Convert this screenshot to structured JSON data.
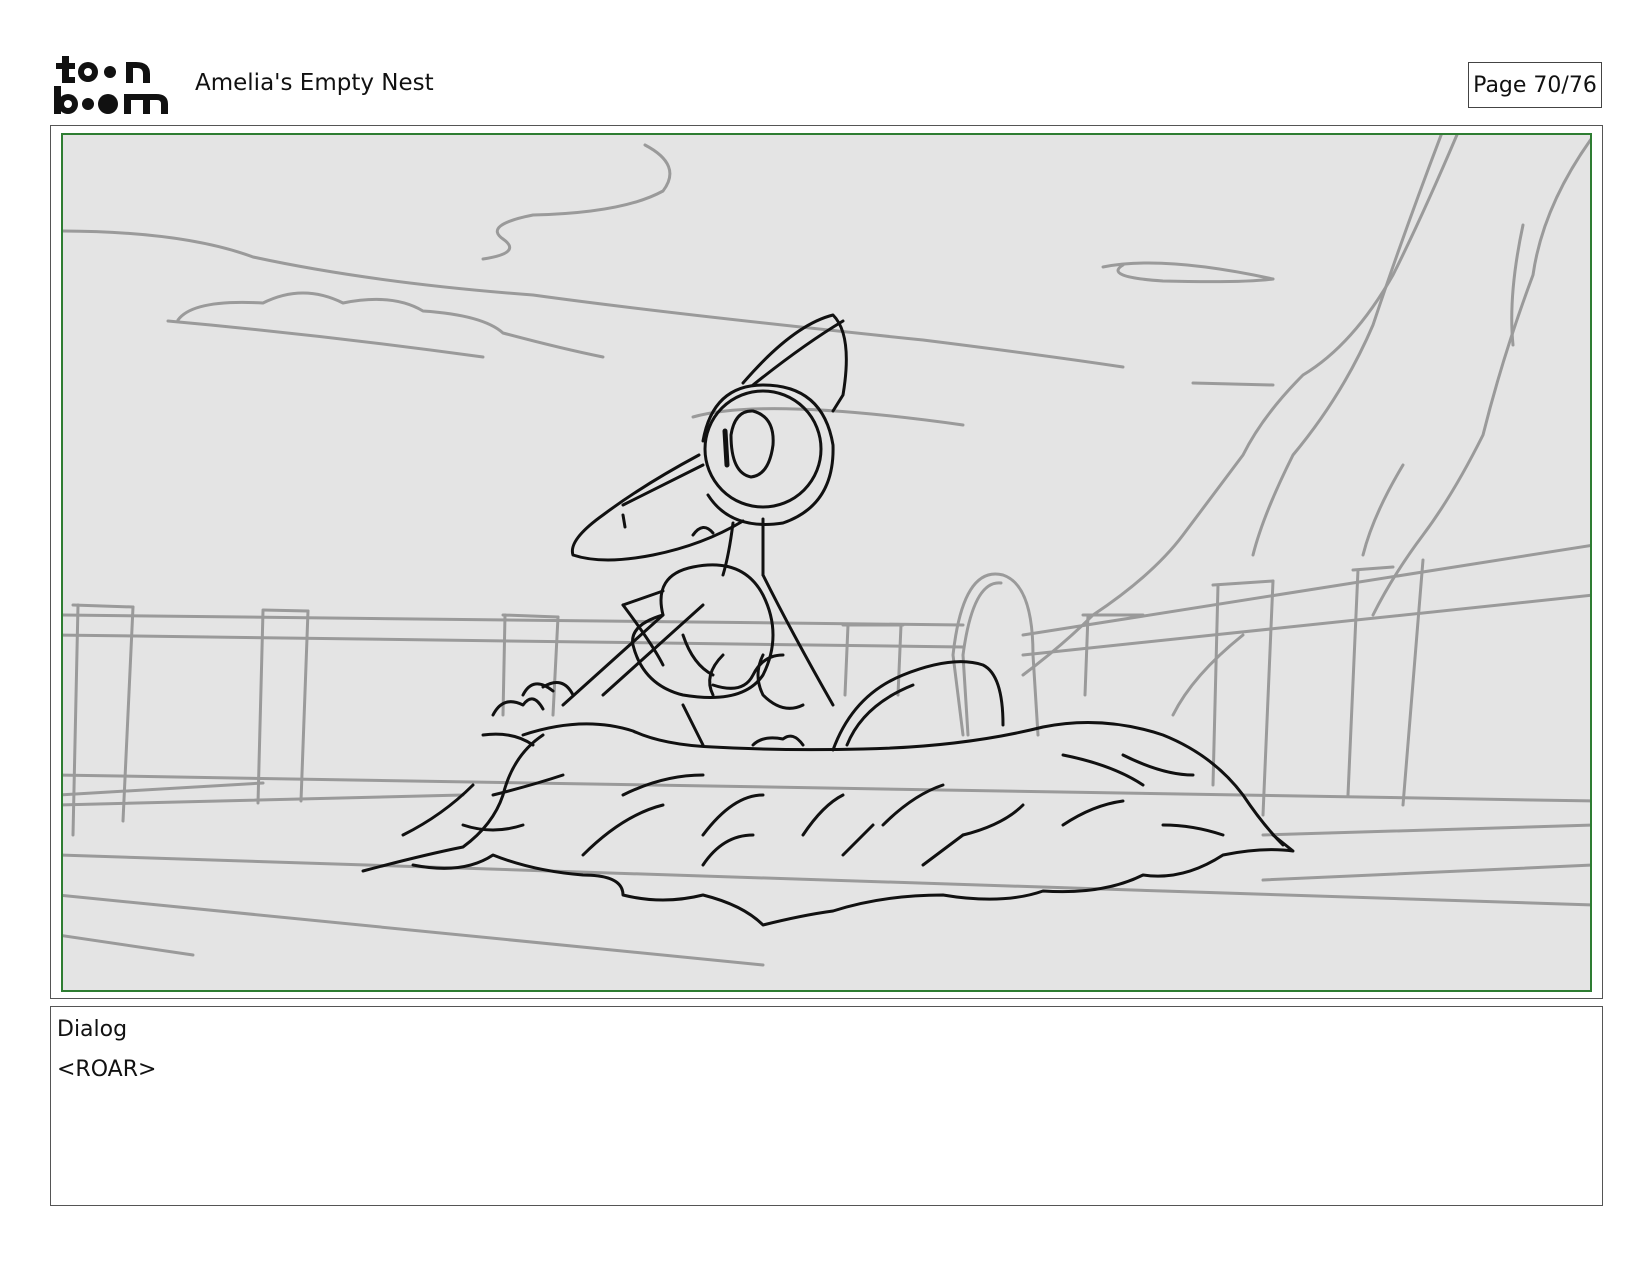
{
  "header": {
    "logo_text": "toon boom",
    "project_title": "Amelia's Empty Nest",
    "page_label": "Page 70/76"
  },
  "panel": {
    "frame_color": "#2e7d32",
    "background_color": "#e4e4e4",
    "sketch_colors": {
      "background": "#9a9a9a",
      "foreground": "#111111"
    }
  },
  "dialog": {
    "label": "Dialog",
    "text": "<ROAR>"
  }
}
